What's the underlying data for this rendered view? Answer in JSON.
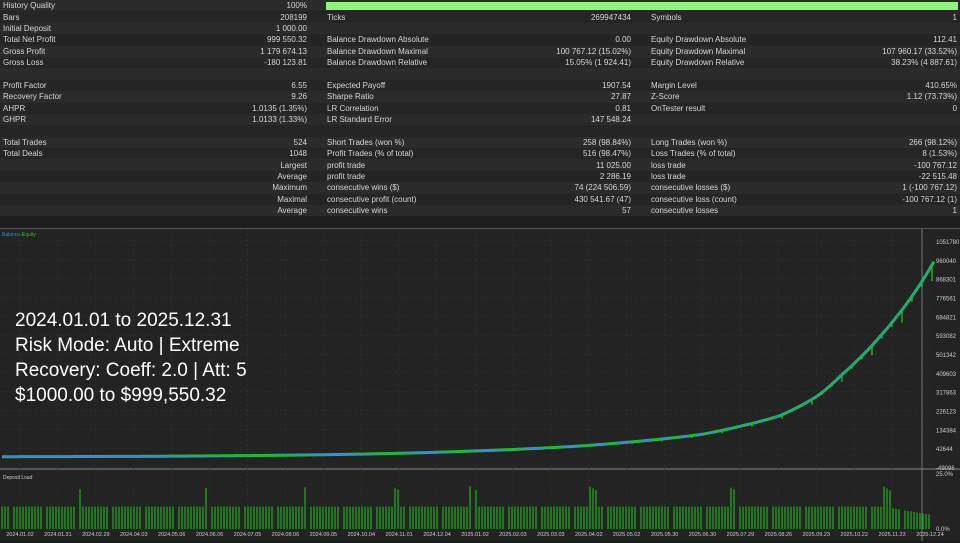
{
  "stats": {
    "history_quality": {
      "label": "History Quality",
      "value": "100%",
      "fill": 1.0
    },
    "rows": [
      [
        "Bars",
        "208199",
        "Ticks",
        "269947434",
        "Symbols",
        "1"
      ],
      [
        "Initial Deposit",
        "1 000.00",
        "",
        "",
        "",
        ""
      ],
      [
        "Total Net Profit",
        "999 550.32",
        "Balance Drawdown Absolute",
        "0.00",
        "Equity Drawdown Absolute",
        "112.41"
      ],
      [
        "Gross Profit",
        "1 179 674.13",
        "Balance Drawdown Maximal",
        "100 767.12 (15.02%)",
        "Equity Drawdown Maximal",
        "107 960.17 (33.52%)"
      ],
      [
        "Gross Loss",
        "-180 123.81",
        "Balance Drawdown Relative",
        "15.05% (1 924.41)",
        "Equity Drawdown Relative",
        "38.23% (4 887.61)"
      ],
      [
        "",
        "",
        "",
        "",
        "",
        ""
      ],
      [
        "Profit Factor",
        "6.55",
        "Expected Payoff",
        "1907.54",
        "Margin Level",
        "410.65%"
      ],
      [
        "Recovery Factor",
        "9.26",
        "Sharpe Ratio",
        "27.87",
        "Z-Score",
        "1.12 (73.73%)"
      ],
      [
        "AHPR",
        "1.0135 (1.35%)",
        "LR Correlation",
        "0.81",
        "OnTester result",
        "0"
      ],
      [
        "GHPR",
        "1.0133 (1.33%)",
        "LR Standard Error",
        "147 548.24",
        "",
        ""
      ],
      [
        "",
        "",
        "",
        "",
        "",
        ""
      ],
      [
        "Total Trades",
        "524",
        "Short Trades (won %)",
        "258 (98.84%)",
        "Long Trades (won %)",
        "266 (98.12%)"
      ],
      [
        "Total Deals",
        "1048",
        "Profit Trades (% of total)",
        "516 (98.47%)",
        "Loss Trades (% of total)",
        "8 (1.53%)"
      ],
      [
        "Largest",
        "",
        "profit trade",
        "11 025.00",
        "loss trade",
        "-100 767.12"
      ],
      [
        "Average",
        "",
        "profit trade",
        "2 286.19",
        "loss trade",
        "-22 515.48"
      ],
      [
        "Maximum",
        "",
        "consecutive wins ($)",
        "74 (224 506.59)",
        "consecutive losses ($)",
        "1 (-100 767.12)"
      ],
      [
        "Maximal",
        "",
        "consecutive profit (count)",
        "430 541.67 (47)",
        "consecutive loss (count)",
        "-100 767.12 (1)"
      ],
      [
        "Average",
        "",
        "consecutive wins",
        "57",
        "consecutive losses",
        "1"
      ]
    ]
  },
  "overlay": [
    "2024.01.01 to 2025.12.31",
    "Risk Mode: Auto | Extreme",
    "Recovery: Coeff: 2.0 | Att: 5",
    "$1000.00 to $999,550.32"
  ],
  "chart_data": [
    {
      "type": "line",
      "title": "Balance / Equity",
      "legend": [
        "Balance",
        "Equity"
      ],
      "colors": {
        "balance": "#2a8fd8",
        "equity": "#22c51e"
      },
      "yticks": [
        "1051780",
        "960040",
        "868301",
        "776561",
        "684821",
        "593082",
        "501342",
        "409603",
        "317863",
        "226123",
        "134384",
        "42644",
        "-49096"
      ],
      "ylim": [
        -49096,
        1051780
      ],
      "x_month": [
        0,
        3,
        6,
        9,
        12,
        15,
        16,
        18,
        19,
        20,
        20.5,
        21,
        21.6,
        22,
        22.6,
        23,
        23.4,
        24
      ],
      "balance": [
        1000,
        2500,
        6000,
        13000,
        28000,
        55000,
        70000,
        110000,
        150000,
        200000,
        245000,
        300000,
        400000,
        470000,
        590000,
        680000,
        780000,
        960040
      ]
    },
    {
      "type": "bar",
      "title": "Deposit Load",
      "ylim_labels": [
        "25.0%",
        "0.0%"
      ],
      "base_load_pct": 10,
      "spike_load_pct": 19,
      "spike_months": [
        1.9,
        5.2,
        7.8,
        10.1,
        12.1,
        15.2,
        18.8,
        22.8
      ],
      "xticks": [
        "2024.01.02",
        "2024.01.31",
        "2024.02.29",
        "2024.04.03",
        "2024.05.06",
        "2024.06.06",
        "2024.07.05",
        "2024.08.06",
        "2024.09.05",
        "2024.10.04",
        "2024.11.01",
        "2024.12.04",
        "2025.01.02",
        "2025.02.03",
        "2025.03.03",
        "2025.04.02",
        "2025.05.02",
        "2025.05.30",
        "2025.06.30",
        "2025.07.29",
        "2025.08.26",
        "2025.09.23",
        "2025.10.22",
        "2025.11.23",
        "2025.12.24"
      ]
    }
  ]
}
